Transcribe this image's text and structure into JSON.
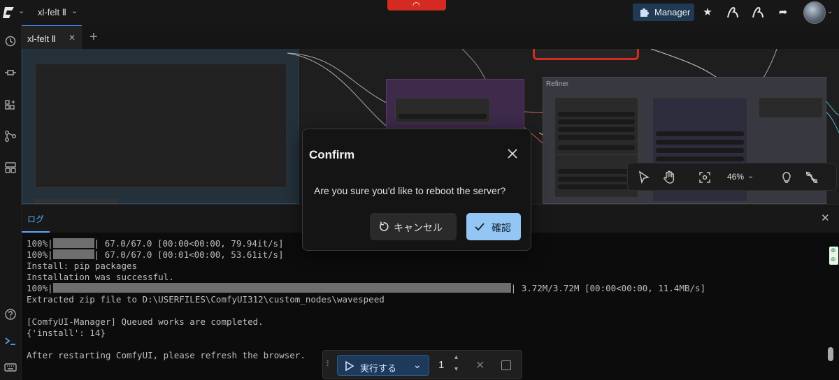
{
  "topbar": {
    "workflow_title": "xl-felt Ⅱ",
    "manager_label": "Manager"
  },
  "tabs": {
    "active_label": "xl-felt Ⅱ"
  },
  "canvas": {
    "group_refiner": "Refiner",
    "zoom_level": "46%"
  },
  "log": {
    "tab_label": "ログ",
    "lines": [
      {
        "pre": "100%|",
        "bar_fraction": 0.09,
        "post": "| 67.0/67.0 [00:00<00:00, 79.94it/s]"
      },
      {
        "pre": "100%|",
        "bar_fraction": 0.09,
        "post": "| 67.0/67.0 [00:01<00:00, 53.61it/s]"
      },
      {
        "text": "Install: pip packages"
      },
      {
        "text": "Installation was successful."
      },
      {
        "pre": "100%|",
        "bar_fraction": 1.0,
        "post": "| 3.72M/3.72M [00:00<00:00, 11.4MB/s]"
      },
      {
        "text": "Extracted zip file to D:\\USERFILES\\ComfyUI312\\custom_nodes\\wavespeed"
      },
      {
        "text": ""
      },
      {
        "text": "[ComfyUI-Manager] Queued works are completed."
      },
      {
        "text": "{'install': 14}"
      },
      {
        "text": ""
      },
      {
        "text": "After restarting ComfyUI, please refresh the browser."
      }
    ]
  },
  "runbar": {
    "run_label": "実行する",
    "count": "1"
  },
  "dialog": {
    "title": "Confirm",
    "message": "Are you sure you'd like to reboot the server?",
    "cancel_label": "キャンセル",
    "confirm_label": "確認"
  },
  "colors": {
    "accent": "#93c6f5",
    "link_blue": "#5aa9ff",
    "danger": "#d42a22"
  },
  "icons": {
    "sidebar": [
      "history-icon",
      "plug-icon",
      "extensions-icon",
      "workflow-icon",
      "templates-icon",
      "help-icon",
      "terminal-icon",
      "keyboard-icon"
    ]
  }
}
